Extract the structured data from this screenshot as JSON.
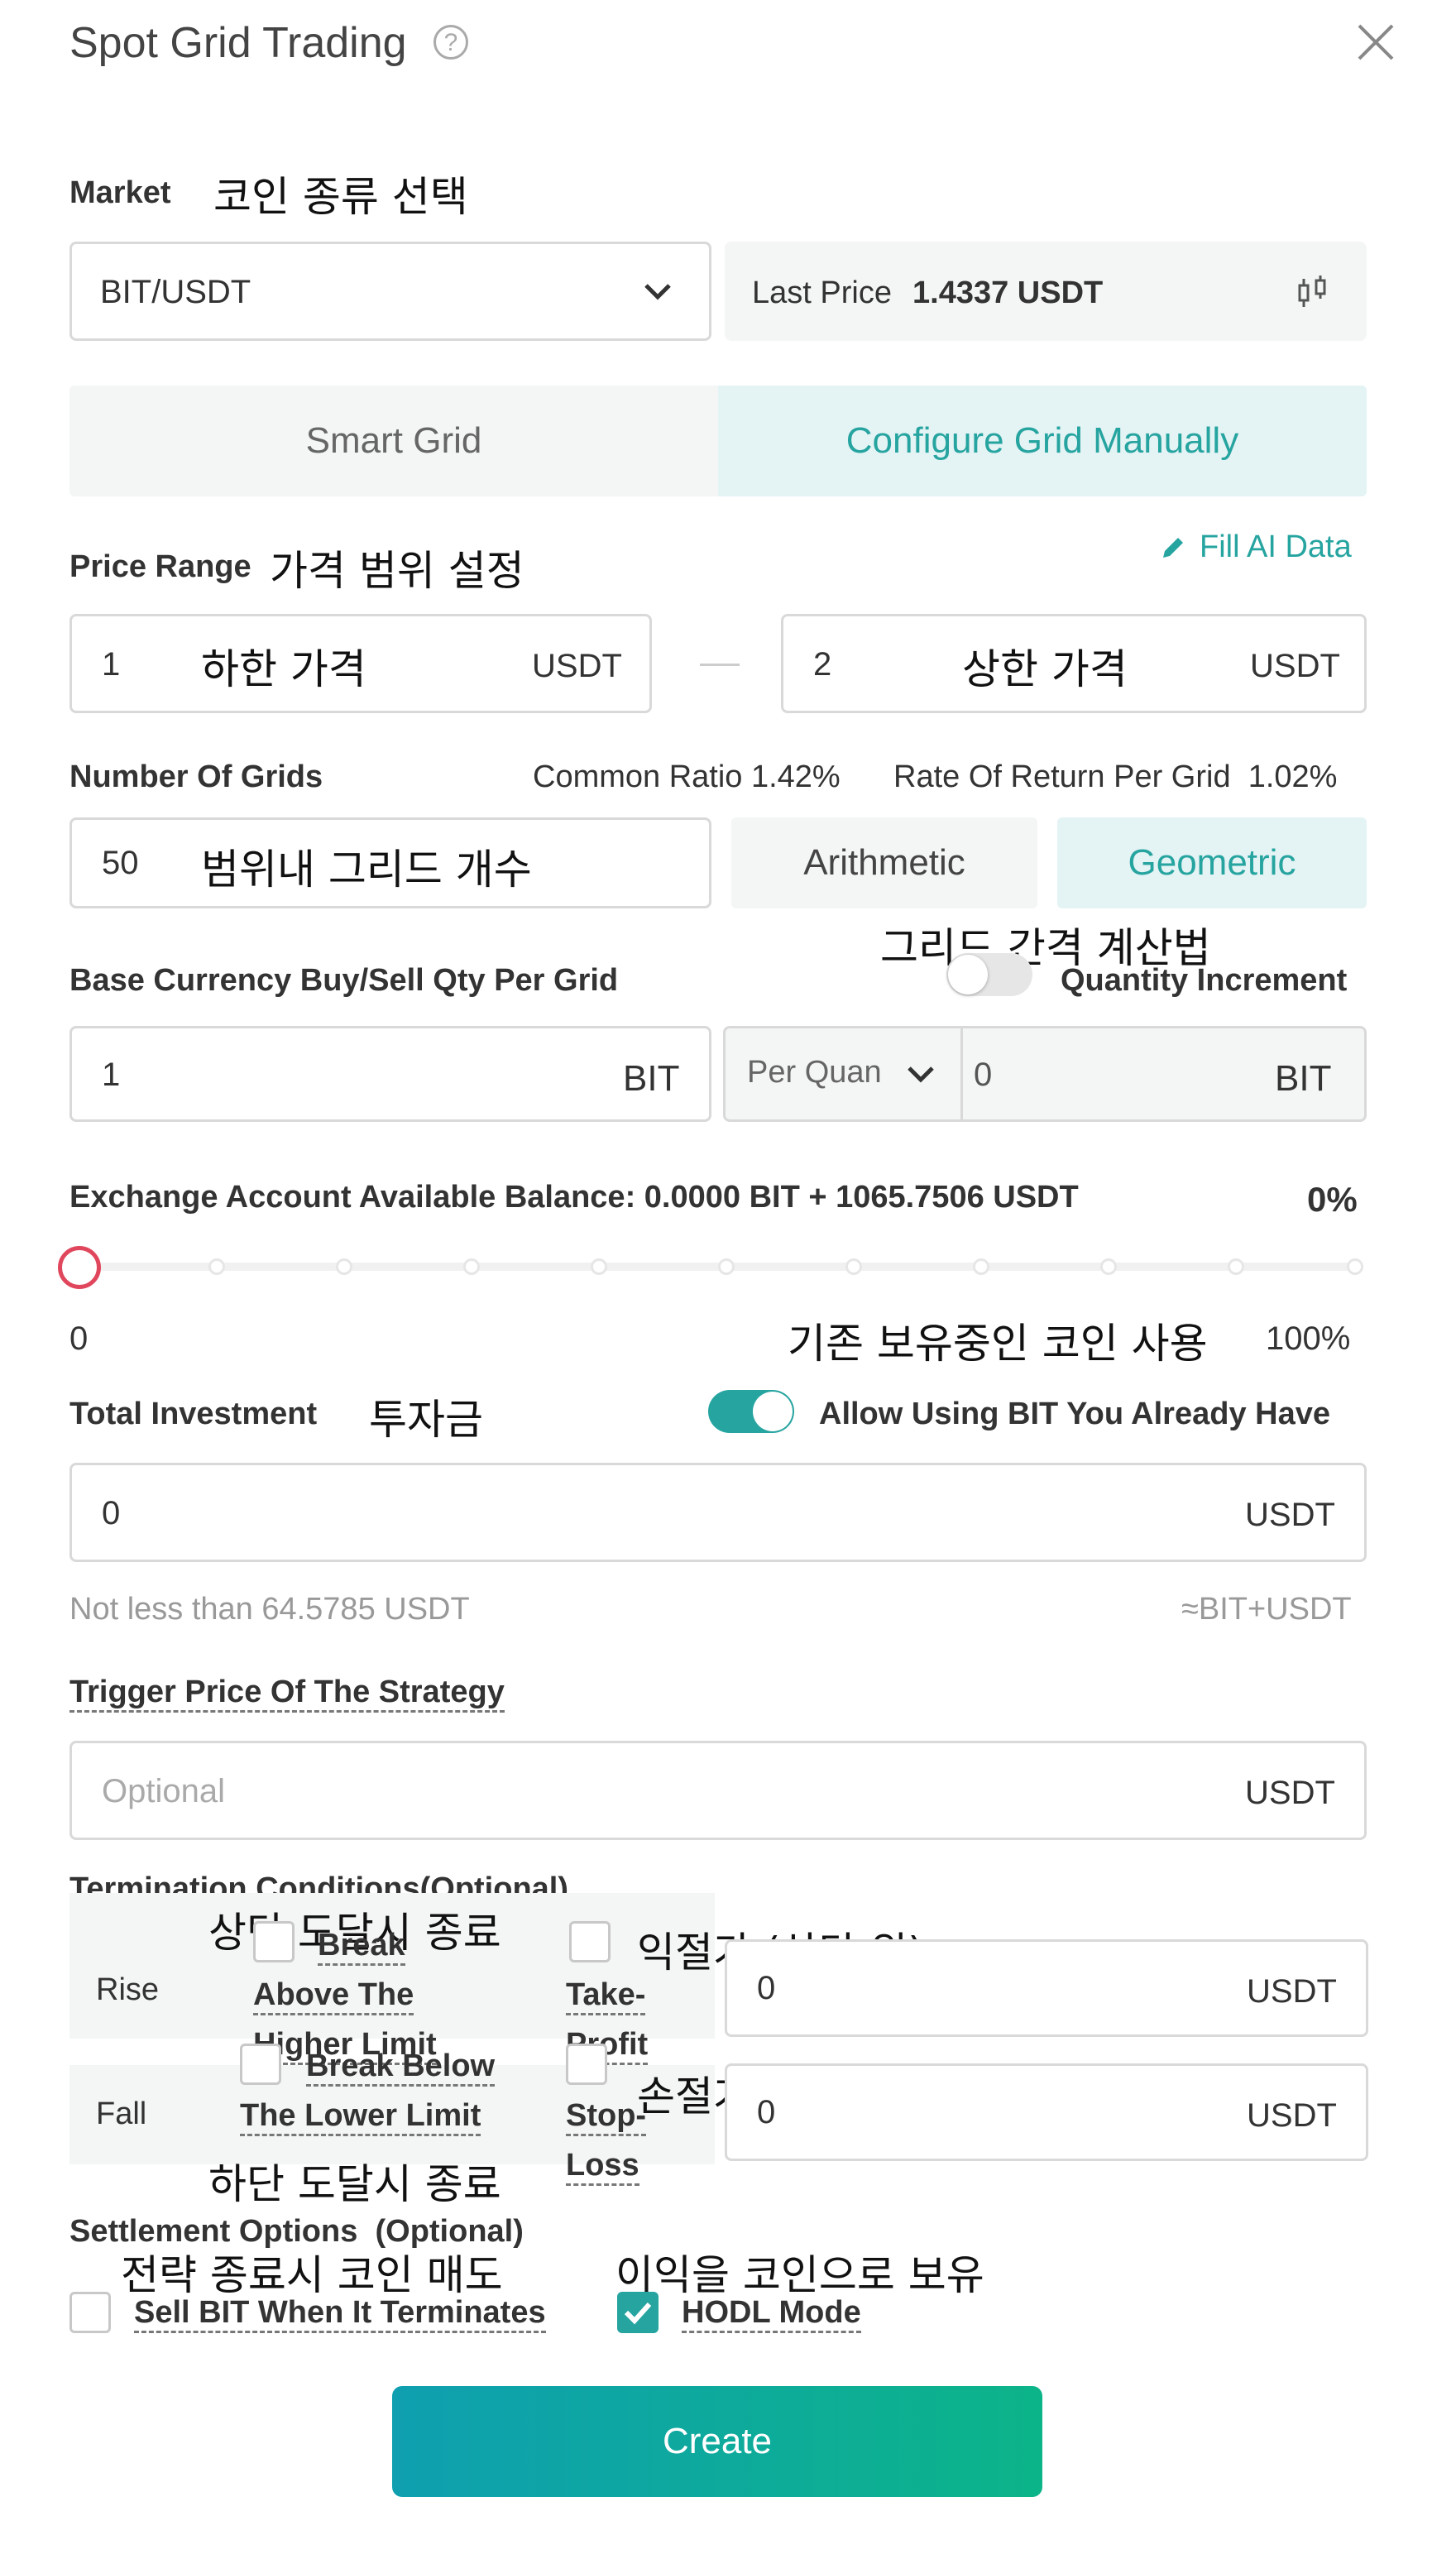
{
  "header": {
    "title": "Spot Grid Trading",
    "help_icon": "question-circle-icon",
    "close_icon": "close-icon"
  },
  "market": {
    "label": "Market",
    "note": "코인 종류 선택",
    "selected": "BIT/USDT",
    "last_price_label": "Last Price",
    "last_price_value": "1.4337 USDT"
  },
  "mode_tabs": {
    "smart": "Smart Grid",
    "manual": "Configure Grid Manually",
    "active": "manual"
  },
  "price_range": {
    "label": "Price Range",
    "note": "가격 범위 설정",
    "fill_ai": "Fill AI Data",
    "lower_value": "1",
    "lower_note": "하한 가격",
    "upper_value": "2",
    "upper_note": "상한 가격",
    "unit": "USDT"
  },
  "grids": {
    "label": "Number Of Grids",
    "common_ratio": "Common Ratio 1.42%",
    "rate_of_return": "Rate Of Return Per Grid  1.02%",
    "value": "50",
    "note": "범위내 그리드 개수",
    "arithmetic": "Arithmetic",
    "geometric": "Geometric",
    "active": "geometric",
    "method_note": "그리드 간격 계산법"
  },
  "base_qty": {
    "label": "Base Currency Buy/Sell Qty Per Grid",
    "toggle_label": "Quantity Increment",
    "toggle_on": false,
    "value": "1",
    "unit": "BIT",
    "select_value": "Per Quan",
    "increment_value": "0",
    "increment_unit": "BIT"
  },
  "balance": {
    "label": "Exchange Account Available Balance: 0.0000 BIT + 1065.7506 USDT",
    "percent": "0%",
    "slider_fraction": 0,
    "min_label": "0",
    "max_label": "100%",
    "note": "기존 보유중인 코인 사용"
  },
  "investment": {
    "label": "Total Investment",
    "note": "투자금",
    "toggle_label": "Allow Using BIT You Already Have",
    "toggle_on": true,
    "value": "0",
    "unit": "USDT",
    "hint": "Not less than 64.5785 USDT",
    "hint_right": "≈BIT+USDT"
  },
  "trigger": {
    "label": "Trigger Price Of The Strategy",
    "placeholder": "Optional",
    "unit": "USDT"
  },
  "termination": {
    "label": "Termination Conditions(Optional)",
    "rise_label": "Rise",
    "rise_break_line1": "Break",
    "rise_break_line2": "Above The",
    "rise_break_line3": "Higher Limit",
    "rise_note": "상단 도달시 종료",
    "take_profit_line1": "Take-",
    "take_profit_line2": "Profit",
    "take_profit_note": "익절가 (상단 위)",
    "rise_value": "0",
    "fall_label": "Fall",
    "fall_break_line1": "Break Below",
    "fall_break_line2": "The Lower Limit",
    "fall_note": "하단 도달시 종료",
    "stop_loss_line1": "Stop-",
    "stop_loss_line2": "Loss",
    "stop_loss_note": "손절가 (하단 아래)",
    "fall_value": "0",
    "unit": "USDT"
  },
  "settlement": {
    "label": "Settlement Options  (Optional)",
    "sell_label": "Sell BIT When It Terminates",
    "sell_note": "전략 종료시 코인 매도",
    "sell_checked": false,
    "hodl_label": "HODL Mode",
    "hodl_note": "이익을 코인으로 보유",
    "hodl_checked": true
  },
  "create_button": "Create",
  "colors": {
    "accent": "#26a4a0",
    "accent_light": "#e4f3f4",
    "slider_handle": "#e0465c",
    "button_start": "#0f9fb0",
    "button_end": "#0cb489"
  }
}
